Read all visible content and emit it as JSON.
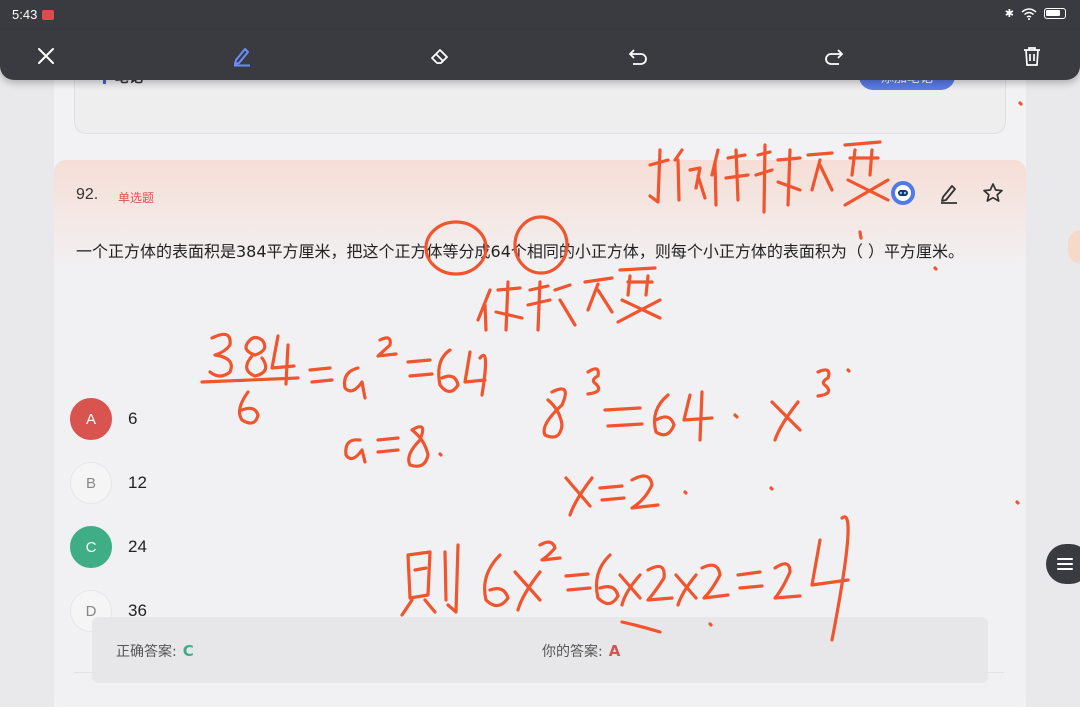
{
  "status": {
    "time": "5:43"
  },
  "toolbar": {
    "items": [
      "close-icon",
      "pen-icon",
      "eraser-icon",
      "undo-icon",
      "redo-icon",
      "trash-icon"
    ]
  },
  "notes": {
    "label": "笔记",
    "add_button": "添加笔记"
  },
  "question": {
    "number": "92.",
    "type": "单选题",
    "text": "一个正方体的表面积是384平方厘米，把这个正方体等分成64个相同的小正方体，则每个小正方体的表面积为（    ）平方厘米。",
    "options": [
      {
        "letter": "A",
        "value": "6",
        "state": "wrong"
      },
      {
        "letter": "B",
        "value": "12",
        "state": "normal"
      },
      {
        "letter": "C",
        "value": "24",
        "state": "right"
      },
      {
        "letter": "D",
        "value": "36",
        "state": "normal"
      }
    ]
  },
  "answers": {
    "correct_label": "正确答案:",
    "correct_value": "C",
    "yours_label": "你的答案:",
    "yours_value": "A"
  },
  "colors": {
    "ink": "#f0552e",
    "accent": "#5b7be6",
    "wrong": "#d9534f",
    "right": "#3fae86"
  }
}
